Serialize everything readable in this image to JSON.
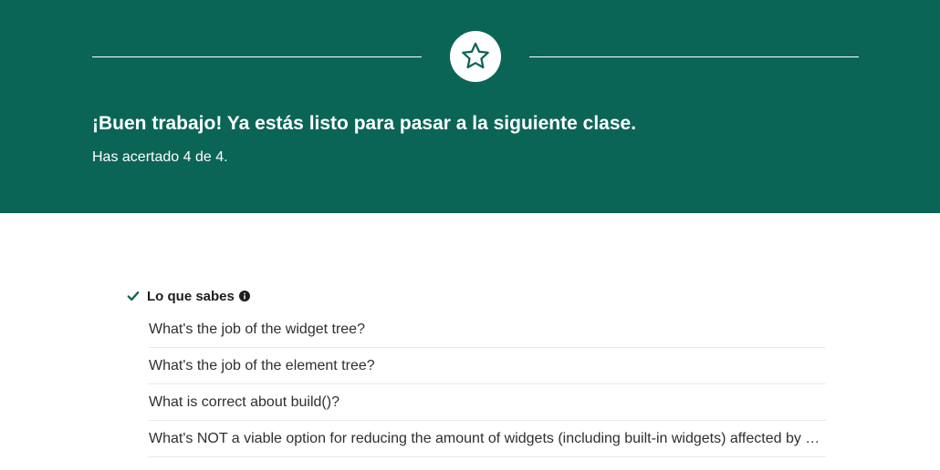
{
  "result": {
    "title": "¡Buen trabajo! Ya estás listo para pasar a la siguiente clase.",
    "score": "Has acertado 4 de 4."
  },
  "section": {
    "title": "Lo que sabes",
    "questions": [
      "What's the job of the widget tree?",
      "What's the job of the element tree?",
      "What is correct about build()?",
      "What's NOT a viable option for reducing the amount of widgets (including built-in widgets) affected by a state change?"
    ]
  },
  "colors": {
    "header_bg": "#0b6556",
    "accent": "#0b6556"
  },
  "icons": {
    "badge": "star-icon",
    "section": "check-icon",
    "info": "info-icon"
  }
}
